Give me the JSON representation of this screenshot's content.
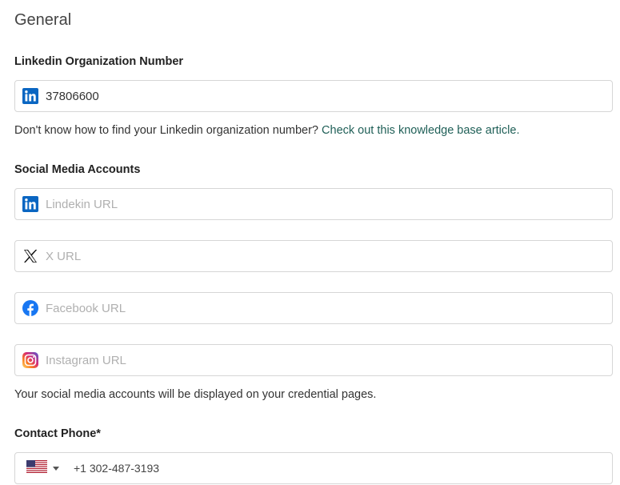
{
  "section": {
    "title": "General"
  },
  "linkedin_org": {
    "label": "Linkedin Organization Number",
    "value": "37806600",
    "icon": "linkedin-icon",
    "help_text": "Don't know how to find your Linkedin organization number? ",
    "help_link": "Check out this knowledge base article."
  },
  "social": {
    "label": "Social Media Accounts",
    "linkedin_placeholder": "Lindekin URL",
    "x_placeholder": "X URL",
    "facebook_placeholder": "Facebook URL",
    "instagram_placeholder": "Instagram URL",
    "help_text": "Your social media accounts will be displayed on your credential pages."
  },
  "phone": {
    "label": "Contact Phone*",
    "country": "us-flag-icon",
    "value": "+1 302-487-3193"
  },
  "colors": {
    "linkedin": "#0a66c2",
    "facebook": "#1877f2",
    "link": "#1f5f57",
    "border": "#d6d6d6"
  }
}
